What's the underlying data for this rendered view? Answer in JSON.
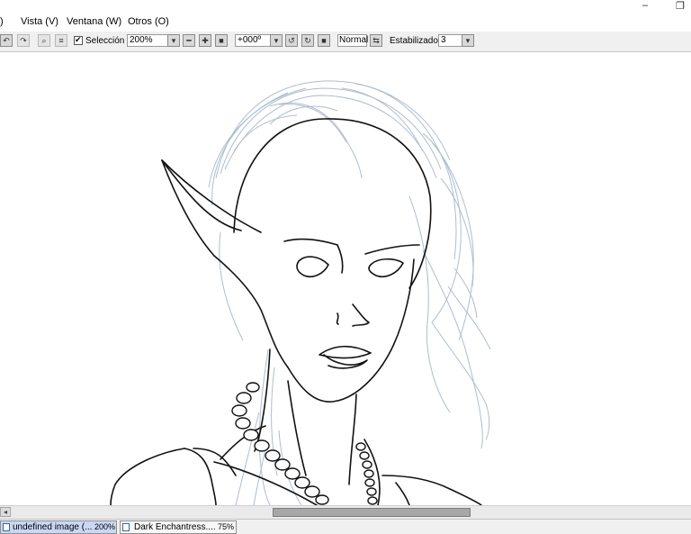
{
  "menu": {
    "items": [
      "Vista (V)",
      "Ventana (W)",
      "Otros (O)"
    ],
    "partial_item": ")"
  },
  "window": {
    "minimize": "–",
    "restore": "❐"
  },
  "toolbar": {
    "selection_label": "Selección",
    "selection_checked": true,
    "zoom_value": "200%",
    "rotation_value": "+000º",
    "blend_mode": "Normal",
    "stabilizer_label": "Estabilizador",
    "stabilizer_value": "3"
  },
  "icons": {
    "undo": "undo-icon",
    "redo": "redo-icon",
    "zoom_dropdown": "chevron-down-icon",
    "zoom_out": "minus-icon",
    "zoom_in": "plus-icon",
    "zoom_reset": "square-icon",
    "rotate_left": "rotate-left-icon",
    "rotate_right": "rotate-right-icon",
    "rotate_reset": "square-icon",
    "flip": "flip-icon"
  },
  "documents": [
    {
      "name": "undefined image (...",
      "zoom": "200%",
      "active": true
    },
    {
      "name": "Dark Enchantress....",
      "zoom": "75%",
      "active": false
    }
  ],
  "colors": {
    "line_art": "#111111",
    "hair_sketch": "#9fb2c6",
    "active_tab": "#c9d8f3"
  }
}
